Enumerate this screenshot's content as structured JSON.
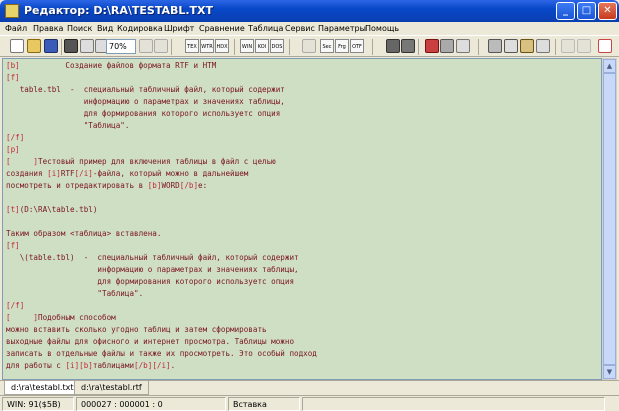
{
  "window": {
    "title": "Редактор: D:\\RA\\TESTABL.TXT"
  },
  "menu": [
    "Файл",
    "Правка",
    "Поиск",
    "Вид",
    "Кодировка",
    "Шрифт",
    "Сравнение",
    "Таблица",
    "Сервис",
    "Параметры",
    "Помощь"
  ],
  "toolbar": {
    "zoom": "70%",
    "enc_buttons": [
      "TEX",
      "WTR",
      "HDX",
      "WIN",
      "KOI",
      "DOS"
    ],
    "fmt_buttons": [
      "Sec",
      "Frg",
      "OTF"
    ]
  },
  "editor": {
    "lines": [
      "[b]          Создание файлов формата RTF и HTM",
      "[f]",
      "   table.tbl  -  специальный табличный файл, который содержит",
      "                 информацию о параметрах и значениях таблицы,",
      "                 для формирования которого используетс опция",
      "                 \"Таблица\".",
      "[/f]",
      "[p]",
      "[     ]Тестовый пример для включения таблицы в файл с целью",
      "создания [i]RTF[/i]-файла, который можно в дальнейшем",
      "посмотреть и отредактировать в [b]WORD[/b]e:",
      "",
      "[t](D:\\RA\\table.tbl)",
      "",
      "Таким образом <таблица> вставлена.",
      "[f]",
      "   \\(table.tbl)  -  специальный табличный файл, который содержит",
      "                    информацию о параметрах и значениях таблицы,",
      "                    для формирования которого используетс опция",
      "                    \"Таблица\".",
      "[/f]",
      "[     ]Подобным способом",
      "можно вставить сколько угодно таблиц и затем сформировать",
      "выходные файлы для офисного и интернет просмотра. Таблицы можно",
      "записать в отдельные файлы и также их просмотреть. Это особый подход",
      "для работы с [i][b]таблицами[/b][/i]."
    ]
  },
  "tabs": [
    "d:\\ra\\testabl.txt",
    "d:\\ra\\testabl.rtf"
  ],
  "status": {
    "encoding": "WIN: 91($5B)",
    "position": "000027 : 000001 : 0",
    "mode": "Вставка"
  }
}
